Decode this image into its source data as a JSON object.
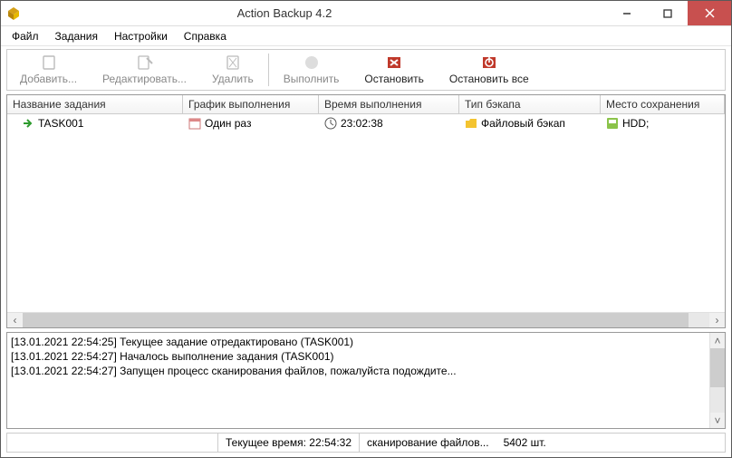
{
  "window": {
    "title": "Action Backup 4.2"
  },
  "menu": {
    "file": "Файл",
    "tasks": "Задания",
    "settings": "Настройки",
    "help": "Справка"
  },
  "toolbar": {
    "add": "Добавить...",
    "edit": "Редактировать...",
    "delete": "Удалить",
    "run": "Выполнить",
    "stop": "Остановить",
    "stop_all": "Остановить все"
  },
  "columns": {
    "name": "Название задания",
    "schedule": "График выполнения",
    "time": "Время выполнения",
    "type": "Тип бэкапа",
    "dest": "Место сохранения"
  },
  "rows": [
    {
      "name": "TASK001",
      "schedule": "Один раз",
      "time": "23:02:38",
      "type": "Файловый бэкап",
      "dest": "HDD;"
    }
  ],
  "log": [
    "[13.01.2021 22:54:25] Текущее задание отредактировано (TASK001)",
    "[13.01.2021 22:54:27] Началось выполнение задания (TASK001)",
    "[13.01.2021 22:54:27] Запущен процесс сканирования файлов, пожалуйста подождите..."
  ],
  "status": {
    "current_time_label": "Текущее время:",
    "current_time_value": "22:54:32",
    "process": "сканирование файлов...",
    "count": "5402 шт."
  }
}
